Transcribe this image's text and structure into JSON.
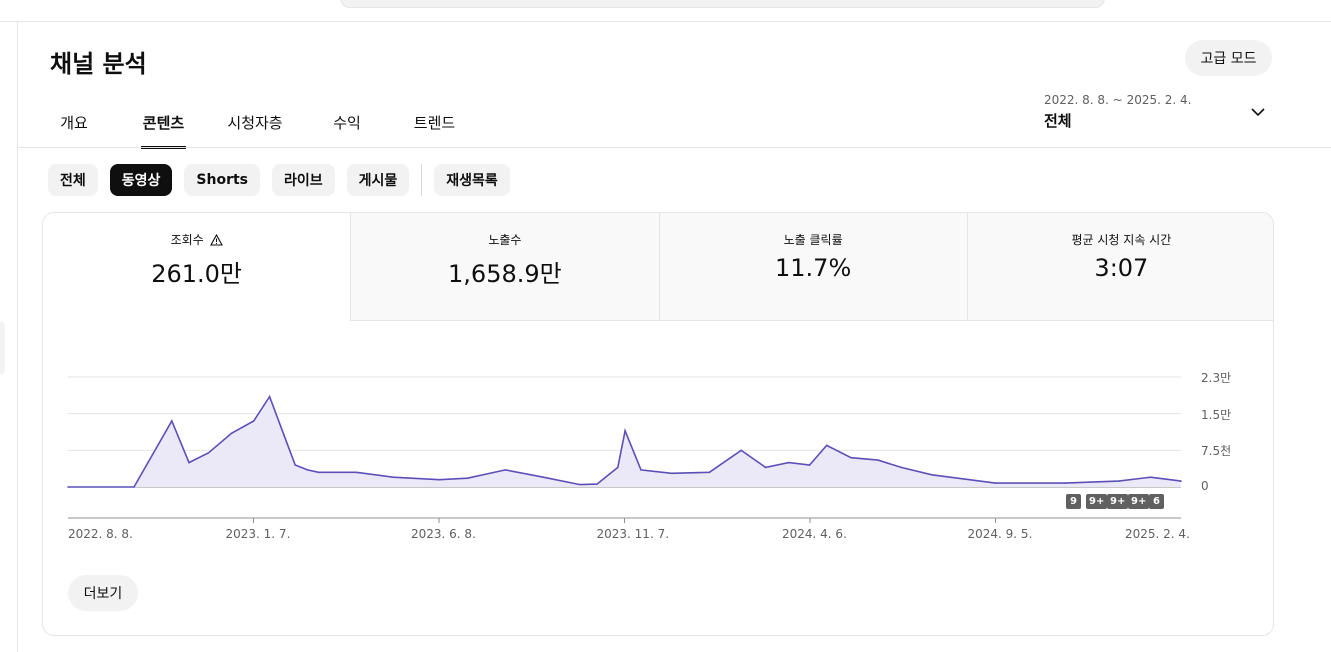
{
  "page": {
    "title": "채널 분석"
  },
  "header": {
    "advanced_mode_label": "고급 모드"
  },
  "tabs": [
    {
      "label": "개요",
      "active": false
    },
    {
      "label": "콘텐츠",
      "active": true
    },
    {
      "label": "시청자층",
      "active": false
    },
    {
      "label": "수익",
      "active": false
    },
    {
      "label": "트렌드",
      "active": false
    }
  ],
  "date_selector": {
    "range": "2022. 8. 8. ~ 2025. 2. 4.",
    "value": "전체"
  },
  "content_chips": [
    {
      "label": "전체",
      "active": false
    },
    {
      "label": "동영상",
      "active": true
    },
    {
      "label": "Shorts",
      "active": false
    },
    {
      "label": "라이브",
      "active": false
    },
    {
      "label": "게시물",
      "active": false
    },
    {
      "label": "재생목록",
      "active": false
    }
  ],
  "metrics": [
    {
      "label": "조회수",
      "value": "261.0만",
      "active": true,
      "warning": true
    },
    {
      "label": "노출수",
      "value": "1,658.9만",
      "active": false,
      "warning": false
    },
    {
      "label": "노출 클릭률",
      "value": "11.7%",
      "active": false,
      "warning": false
    },
    {
      "label": "평균 시청 지속 시간",
      "value": "3:07",
      "active": false,
      "warning": false
    }
  ],
  "chart_data": {
    "type": "area",
    "metric": "조회수",
    "xlabel": "",
    "ylabel": "",
    "ylim": [
      0,
      22500
    ],
    "y_ticks": [
      "0",
      "7.5천",
      "1.5만",
      "2.3만"
    ],
    "y_tick_values": [
      0,
      7500,
      15000,
      22500
    ],
    "x_ticks": [
      "2022. 8. 8.",
      "2023. 1. 7.",
      "2023. 6. 8.",
      "2023. 11. 7.",
      "2024. 4. 6.",
      "2024. 9. 5.",
      "2025. 2. 4."
    ],
    "x": [
      "2022-08-08",
      "2022-10-01",
      "2022-11-01",
      "2022-11-15",
      "2022-12-01",
      "2022-12-20",
      "2023-01-07",
      "2023-01-20",
      "2023-02-01",
      "2023-02-10",
      "2023-02-20",
      "2023-03-01",
      "2023-04-01",
      "2023-05-01",
      "2023-06-08",
      "2023-07-01",
      "2023-08-01",
      "2023-09-01",
      "2023-10-01",
      "2023-10-15",
      "2023-11-01",
      "2023-11-07",
      "2023-11-20",
      "2023-12-15",
      "2024-01-15",
      "2024-02-10",
      "2024-03-01",
      "2024-03-20",
      "2024-04-06",
      "2024-04-20",
      "2024-05-10",
      "2024-06-01",
      "2024-06-20",
      "2024-07-15",
      "2024-09-05",
      "2024-11-01",
      "2024-12-15",
      "2025-01-10",
      "2025-02-04"
    ],
    "values": [
      0,
      0,
      13500,
      5000,
      7000,
      11000,
      13500,
      18500,
      10500,
      4500,
      3500,
      3000,
      3000,
      2000,
      1500,
      1800,
      3500,
      2000,
      500,
      600,
      4000,
      11500,
      3500,
      2800,
      3000,
      7500,
      4000,
      5000,
      4500,
      8500,
      6000,
      5500,
      4000,
      2500,
      800,
      800,
      1200,
      2000,
      1200
    ],
    "series_color": "#5c50b8",
    "grid": true,
    "annotation_badges": [
      "9",
      "9+",
      "9+",
      "9+",
      "6"
    ]
  },
  "footer": {
    "more_label": "더보기"
  }
}
